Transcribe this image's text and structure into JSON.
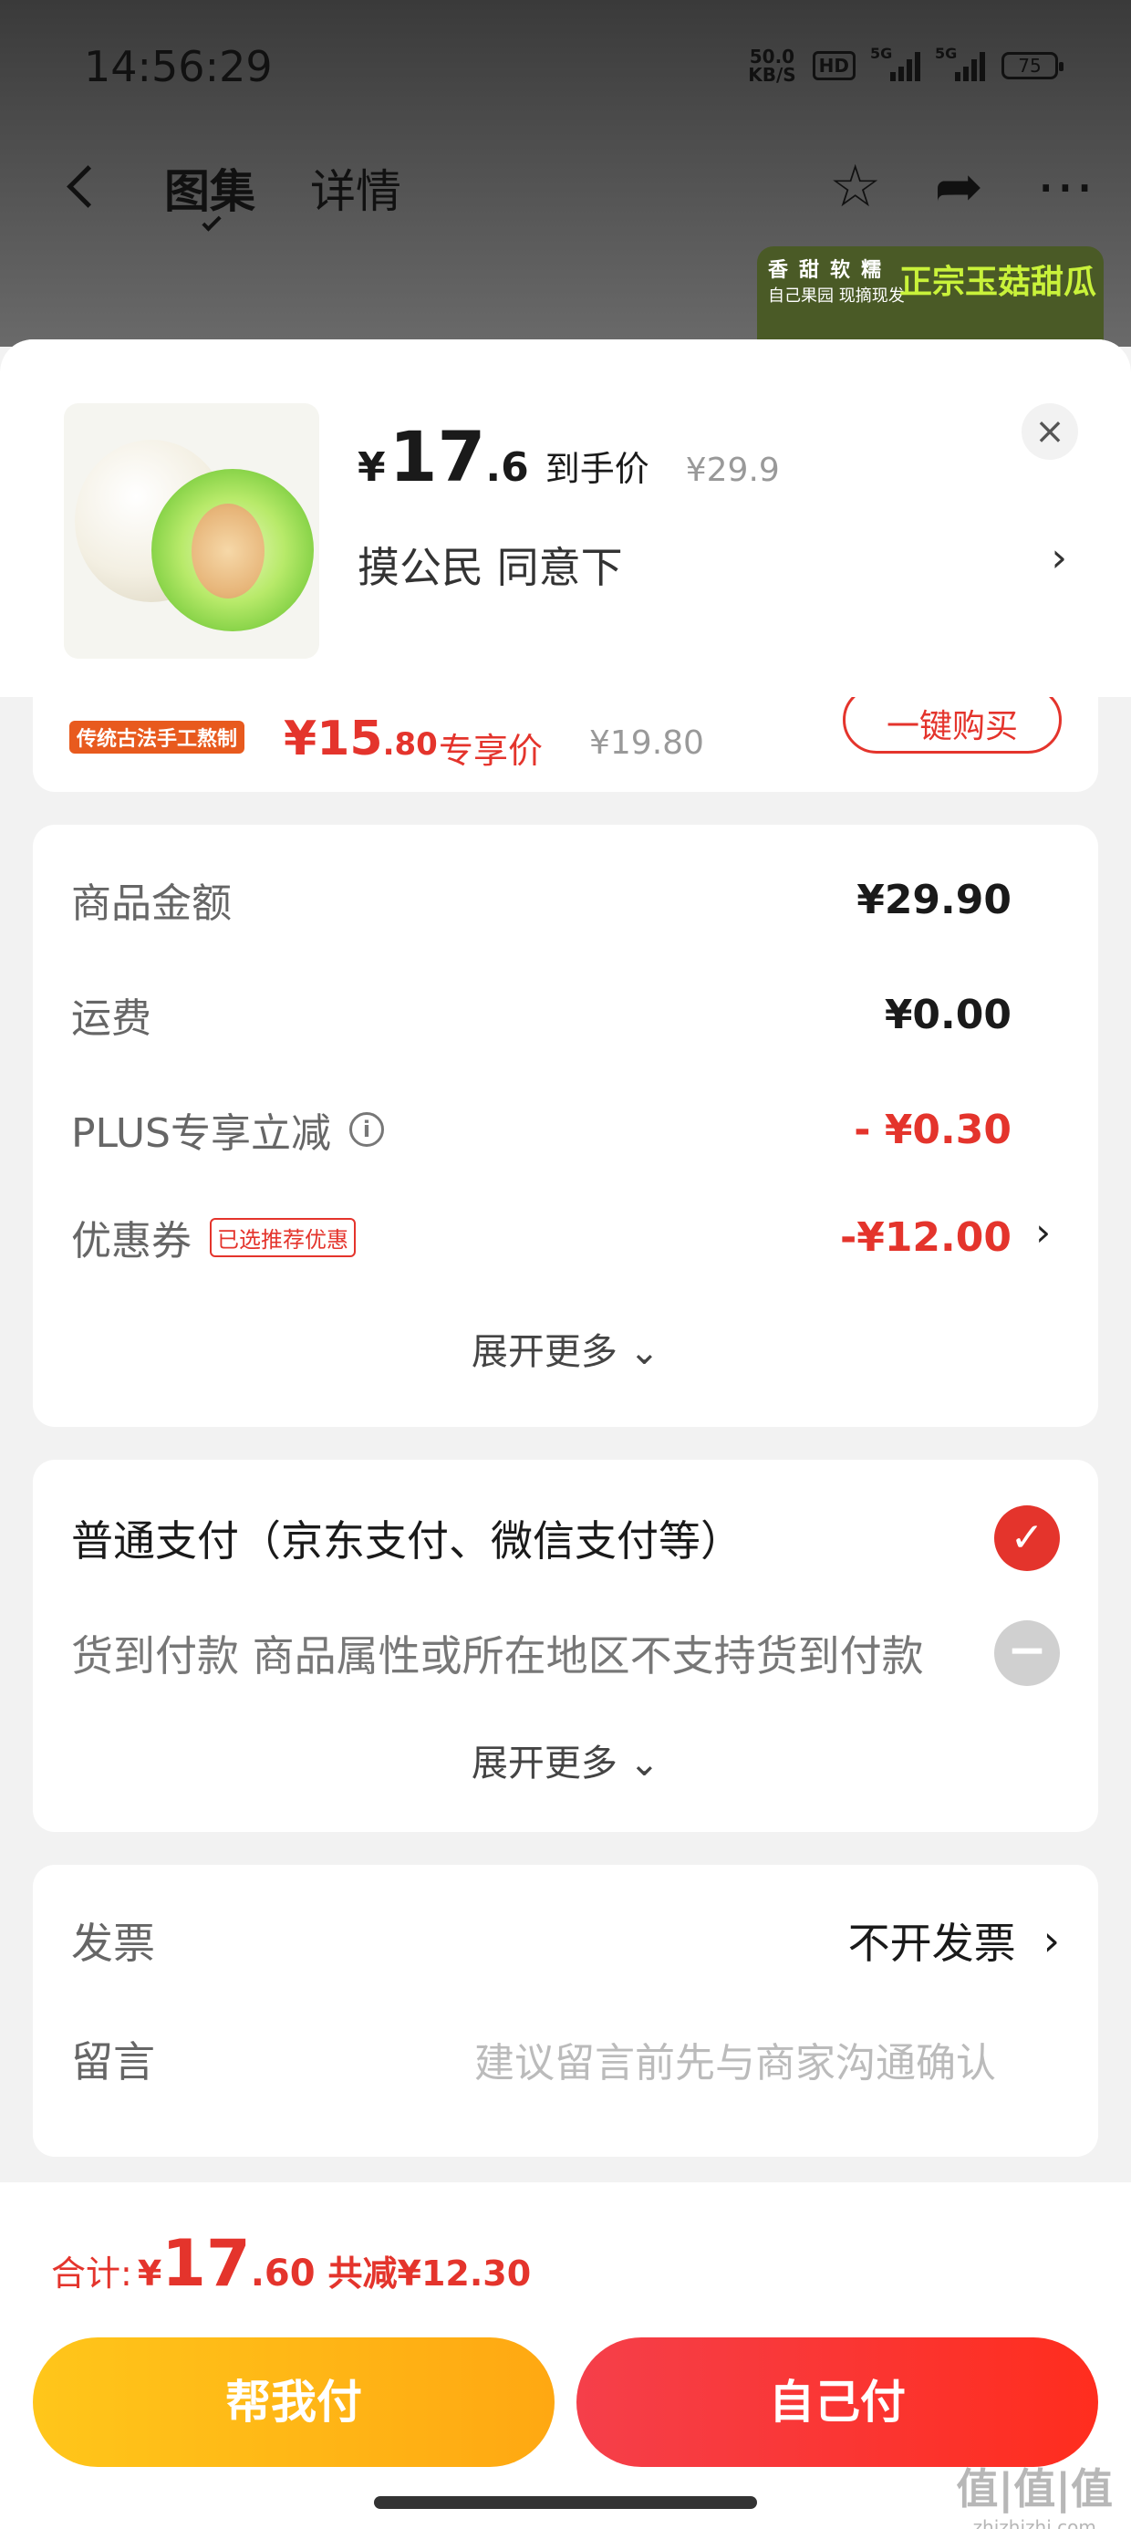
{
  "status_bar": {
    "time": "14:56:29",
    "net_speed_value": "50.0",
    "net_speed_unit": "KB/S",
    "hd": "HD",
    "signal1": "5G",
    "signal2": "5G",
    "battery": "75"
  },
  "nav": {
    "tabs": [
      {
        "label": "图集"
      },
      {
        "label": "详情"
      }
    ],
    "icons": [
      "star-icon",
      "share-icon",
      "more-icon"
    ]
  },
  "preview": {
    "line1": "香甜软糯",
    "line2": "自己果园 现摘现发",
    "title": "正宗玉菇甜瓜"
  },
  "product": {
    "price_yen": "¥",
    "price_int": "17",
    "price_dec": ".6",
    "price_label": "到手价",
    "orig_price": "¥29.9",
    "spec": "摸公民  同意下",
    "close": "×",
    "arrow": "›"
  },
  "partial_card": {
    "badge": "传统古法手工熬制",
    "price_yen": "¥",
    "price_int": "15",
    "price_dec": ".80",
    "tag": "专享价",
    "orig": "¥19.80",
    "button": "一键购买"
  },
  "amount": {
    "rows": [
      {
        "label": "商品金额",
        "value": "¥29.90"
      },
      {
        "label": "运费",
        "value": "¥0.00"
      },
      {
        "label": "PLUS专享立减",
        "value": "- ¥0.30"
      },
      {
        "label": "优惠券",
        "tag": "已选推荐优惠",
        "value": "-¥12.00"
      }
    ],
    "info": "i",
    "arrow": "›",
    "expand": "展开更多 ⌄"
  },
  "payment": {
    "normal": "普通支付（京东支付、微信支付等）",
    "cod": "货到付款 商品属性或所在地区不支持货到付款",
    "check": "✓",
    "disabled": "−",
    "expand": "展开更多 ⌄"
  },
  "invoice": {
    "label": "发票",
    "value": "不开发票",
    "arrow": "›",
    "note_label": "留言",
    "note_placeholder": "建议留言前先与商家沟通确认"
  },
  "bottom": {
    "total_label": "合计:",
    "total_yen": "¥",
    "total_int": "17",
    "total_dec": ".60",
    "saved": "共减¥12.30",
    "btn_helper": "帮我付",
    "btn_self": "自己付"
  },
  "watermark": {
    "text": "值|值|值",
    "url": "zhizhizhi.com"
  },
  "colors": {
    "accent_red": "#e4342c",
    "helper_yellow": "#ffb814",
    "self_red": "#f53f4a"
  }
}
